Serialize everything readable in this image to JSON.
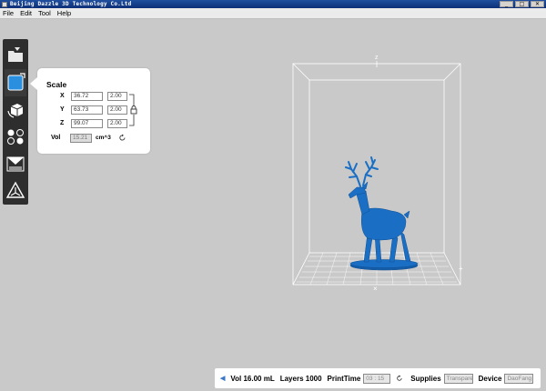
{
  "window": {
    "title": "Beijing Dazzle 3D Technology Co.Ltd",
    "buttons": {
      "minimize": "_",
      "maximize": "□",
      "close": "✕"
    }
  },
  "menu": [
    "File",
    "Edit",
    "Tool",
    "Help"
  ],
  "toolbar": {
    "tools": [
      {
        "icon": "open-file-icon",
        "active": false
      },
      {
        "icon": "scale-cube-icon",
        "active": true
      },
      {
        "icon": "rotate-cube-icon",
        "active": false
      },
      {
        "icon": "support-nodes-icon",
        "active": false
      },
      {
        "icon": "slice-layers-icon",
        "active": false
      },
      {
        "icon": "print-triangle-icon",
        "active": false
      }
    ]
  },
  "scale_panel": {
    "title": "Scale",
    "rows": [
      {
        "axis": "X",
        "size": "36.72",
        "factor": "2.00"
      },
      {
        "axis": "Y",
        "size": "63.73",
        "factor": "2.00"
      },
      {
        "axis": "Z",
        "size": "99.07",
        "factor": "2.00"
      }
    ],
    "vol_label": "Vol",
    "vol_value": "15.21",
    "vol_unit": "cm^3"
  },
  "viewport": {
    "z_axis_label": "z",
    "model_color": "#1a6fc4"
  },
  "status": {
    "vol": "Vol 16.00 mL",
    "layers": "Layers 1000",
    "printtime_label": "PrintTime",
    "printtime_value": "03 : 15",
    "supplies_label": "Supplies",
    "supplies_value": "Transparent",
    "device_label": "Device",
    "device_value": "DaoFang"
  },
  "colors": {
    "accent": "#3b78c4",
    "titlebar": "#1a4595",
    "background": "#c9c9c9"
  }
}
